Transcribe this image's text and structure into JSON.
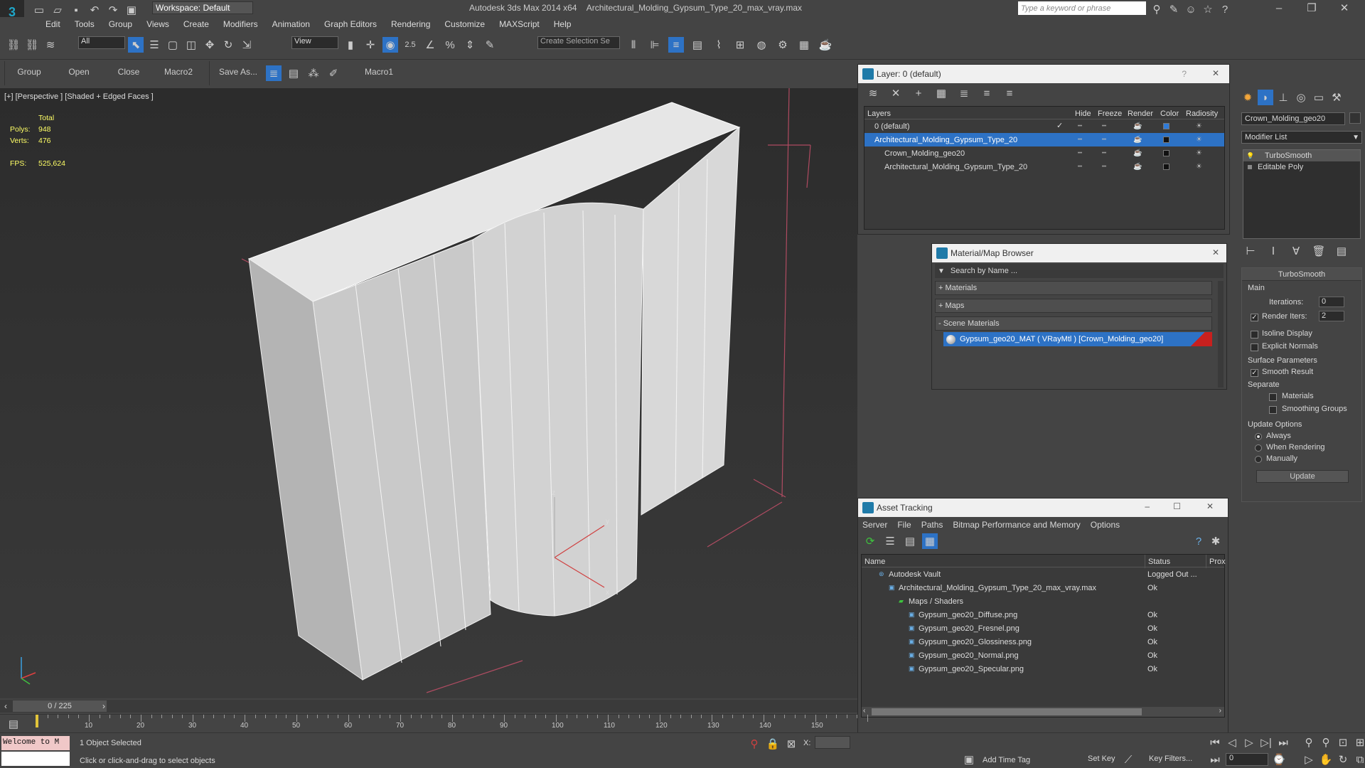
{
  "title": {
    "app": "Autodesk 3ds Max  2014 x64",
    "file": "Architectural_Molding_Gypsum_Type_20_max_vray.max",
    "workspace": "Workspace: Default",
    "search_placeholder": "Type a keyword or phrase"
  },
  "menu": [
    "Edit",
    "Tools",
    "Group",
    "Views",
    "Create",
    "Modifiers",
    "Animation",
    "Graph Editors",
    "Rendering",
    "Customize",
    "MAXScript",
    "Help"
  ],
  "toolbar": {
    "filter_value": "All",
    "refcoord_value": "View",
    "snap_label": "2.5",
    "selection_set_placeholder": "Create Selection Se"
  },
  "toolbar2": [
    "Group",
    "Open",
    "Close",
    "Macro2",
    "Save As...",
    "Macro1"
  ],
  "viewport": {
    "label": "[+] [Perspective ] [Shaded + Edged Faces ]",
    "stats_header": "Total",
    "polys_label": "Polys:",
    "polys_value": "948",
    "verts_label": "Verts:",
    "verts_value": "476",
    "fps_label": "FPS:",
    "fps_value": "525,624"
  },
  "layer_panel": {
    "title": "Layer: 0 (default)",
    "columns": [
      "Layers",
      "Hide",
      "Freeze",
      "Render",
      "Color",
      "Radiosity"
    ],
    "rows": [
      {
        "name": "0 (default)",
        "indent": 1,
        "color": "#2f7bd8"
      },
      {
        "name": "Architectural_Molding_Gypsum_Type_20",
        "indent": 1,
        "color": "#111111",
        "selected": true
      },
      {
        "name": "Crown_Molding_geo20",
        "indent": 2,
        "color": "#111111"
      },
      {
        "name": "Architectural_Molding_Gypsum_Type_20",
        "indent": 2,
        "color": "#111111"
      }
    ]
  },
  "material_browser": {
    "title": "Material/Map Browser",
    "search_placeholder": "Search by Name ...",
    "sections": [
      "+ Materials",
      "+ Maps",
      "- Scene Materials"
    ],
    "scene_material": "Gypsum_geo20_MAT ( VRayMtl ) [Crown_Molding_geo20]"
  },
  "asset_tracking": {
    "title": "Asset Tracking",
    "menu": [
      "Server",
      "File",
      "Paths",
      "Bitmap Performance and Memory",
      "Options"
    ],
    "columns": [
      "Name",
      "Status",
      "Prox"
    ],
    "rows": [
      {
        "name": "Autodesk Vault",
        "status": "Logged Out ...",
        "indent": 1
      },
      {
        "name": "Architectural_Molding_Gypsum_Type_20_max_vray.max",
        "status": "Ok",
        "indent": 2
      },
      {
        "name": "Maps / Shaders",
        "status": "",
        "indent": 3
      },
      {
        "name": "Gypsum_geo20_Diffuse.png",
        "status": "Ok",
        "indent": 4
      },
      {
        "name": "Gypsum_geo20_Fresnel.png",
        "status": "Ok",
        "indent": 4
      },
      {
        "name": "Gypsum_geo20_Glossiness.png",
        "status": "Ok",
        "indent": 4
      },
      {
        "name": "Gypsum_geo20_Normal.png",
        "status": "Ok",
        "indent": 4
      },
      {
        "name": "Gypsum_geo20_Specular.png",
        "status": "Ok",
        "indent": 4
      }
    ]
  },
  "command_panel": {
    "object_name": "Crown_Molding_geo20",
    "modifier_list": "Modifier List",
    "stack": [
      "TurboSmooth",
      "Editable Poly"
    ],
    "rollout_title": "TurboSmooth",
    "main_label": "Main",
    "iterations_label": "Iterations:",
    "iterations_value": "0",
    "render_iters_label": "Render Iters:",
    "render_iters_value": "2",
    "isoline_label": "Isoline Display",
    "explicit_normals_label": "Explicit Normals",
    "surface_params_label": "Surface Parameters",
    "smooth_result_label": "Smooth Result",
    "separate_label": "Separate",
    "materials_label": "Materials",
    "smoothing_groups_label": "Smoothing Groups",
    "update_options_label": "Update Options",
    "always_label": "Always",
    "when_rendering_label": "When Rendering",
    "manually_label": "Manually",
    "update_button": "Update"
  },
  "timeline": {
    "frame_display": "0 / 225",
    "ticks": [
      "10",
      "20",
      "30",
      "40",
      "50",
      "60",
      "70",
      "80",
      "90",
      "100",
      "110",
      "120",
      "130",
      "140",
      "150"
    ]
  },
  "status": {
    "maxscript": "Welcome to M",
    "selected": "1 Object Selected",
    "prompt": "Click or click-and-drag to select objects",
    "x_label": "X:",
    "add_time_tag": "Add Time Tag",
    "set_key": "Set Key",
    "key_filters": "Key Filters...",
    "frame_value": "0"
  },
  "colors": {
    "accent": "#2d72c5",
    "viewport_bg": "#333333",
    "material_swatch": "#c8201e"
  }
}
